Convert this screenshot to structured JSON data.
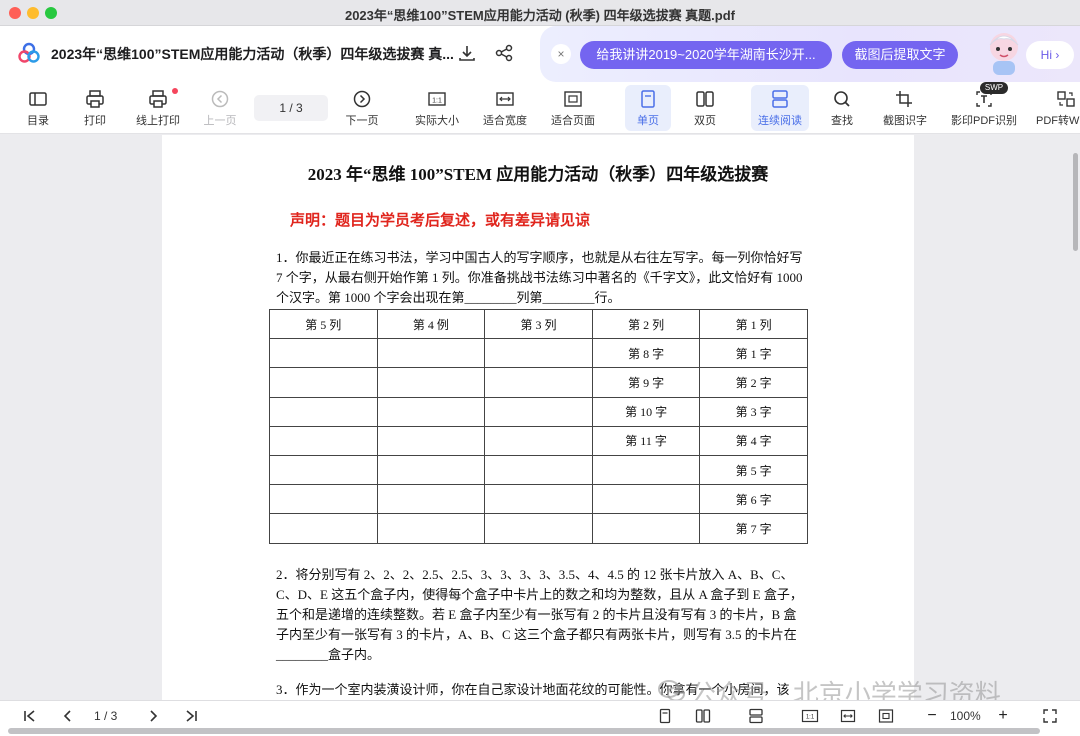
{
  "window": {
    "title": "2023年“思维100”STEM应用能力活动 (秋季) 四年级选拔赛 真题.pdf"
  },
  "header": {
    "doc_title": "2023年“思维100”STEM应用能力活动（秋季）四年级选拔赛 真...",
    "ai_chip_1": "给我讲讲2019~2020学年湖南长沙开...",
    "ai_chip_2": "截图后提取文字",
    "hi": "Hi ›",
    "close": "×"
  },
  "toolbar": {
    "toc": "目录",
    "print": "打印",
    "online_print": "线上打印",
    "prev_page": "上一页",
    "page_indicator": "1  /  3",
    "next_page": "下一页",
    "actual_size": "实际大小",
    "fit_width": "适合宽度",
    "fit_page": "适合页面",
    "single_page": "单页",
    "double_page": "双页",
    "continuous": "连续阅读",
    "find": "查找",
    "ocr_screenshot": "截图识字",
    "scan_ocr": "影印PDF识别",
    "convert": "PDF转W",
    "swp_badge": "SWP"
  },
  "document": {
    "heading": "2023 年“思维 100”STEM 应用能力活动（秋季）四年级选拔赛",
    "notice": "声明：题目为学员考后复述，或有差异请见谅",
    "q1": "1．你最近正在练习书法，学习中国古人的写字顺序，也就是从右往左写字。每一列你恰好写 7 个字，从最右侧开始作第 1 列。你准备挑战书法练习中著名的《千字文》，此文恰好有 1000 个汉字。第 1000 个字会出现在第________列第________行。",
    "table_header": [
      "第 5 列",
      "第 4 例",
      "第 3 列",
      "第 2 列",
      "第 1 列"
    ],
    "table_rows": [
      [
        "",
        "",
        "",
        "第 8 字",
        "第 1 字"
      ],
      [
        "",
        "",
        "",
        "第 9 字",
        "第 2 字"
      ],
      [
        "",
        "",
        "",
        "第 10 字",
        "第 3 字"
      ],
      [
        "",
        "",
        "",
        "第 11 字",
        "第 4 字"
      ],
      [
        "",
        "",
        "",
        "",
        "第 5 字"
      ],
      [
        "",
        "",
        "",
        "",
        "第 6 字"
      ],
      [
        "",
        "",
        "",
        "",
        "第 7 字"
      ]
    ],
    "q2": "2．将分别写有 2、2、2、2.5、2.5、3、3、3、3、3.5、4、4.5 的 12 张卡片放入 A、B、C、C、D、E 这五个盒子内，使得每个盒子中卡片上的数之和均为整数，且从 A 盒子到 E 盒子，五个和是递增的连续整数。若 E 盒子内至少有一张写有 2 的卡片且没有写有 3 的卡片，B 盒子内至少有一张写有 3 的卡片，A、B、C 这三个盒子都只有两张卡片，则写有 3.5 的卡片在________盒子内。",
    "q3": "3．作为一个室内装潢设计师，你在自己家设计地面花纹的可能性。你拿有一个小房间，该"
  },
  "bottom": {
    "page_indicator": "1  /  3",
    "zoom": "100%",
    "zoom_out": "−",
    "zoom_in": "+"
  },
  "watermark": "公众号 · 北京小学学习资料"
}
